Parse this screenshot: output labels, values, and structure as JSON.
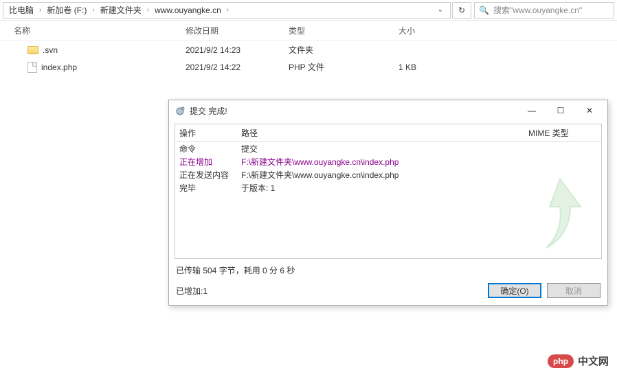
{
  "addressbar": {
    "crumbs": [
      "比电脑",
      "新加卷 (F:)",
      "新建文件夹",
      "www.ouyangke.cn"
    ],
    "search_placeholder": "搜索\"www.ouyangke.cn\""
  },
  "columns": {
    "name": "名称",
    "date": "修改日期",
    "type": "类型",
    "size": "大小"
  },
  "files": [
    {
      "icon": "folder",
      "name": ".svn",
      "date": "2021/9/2 14:23",
      "type": "文件夹",
      "size": ""
    },
    {
      "icon": "file",
      "name": "index.php",
      "date": "2021/9/2 14:22",
      "type": "PHP 文件",
      "size": "1 KB"
    }
  ],
  "dialog": {
    "title": "提交 完成!",
    "log_headers": {
      "op": "操作",
      "path": "路径",
      "mime": "MIME 类型"
    },
    "log_rows": [
      {
        "op": "命令",
        "path": "提交",
        "style": "normal"
      },
      {
        "op": "正在增加",
        "path": "F:\\新建文件夹\\www.ouyangke.cn\\index.php",
        "style": "purple"
      },
      {
        "op": "正在发送内容",
        "path": "F:\\新建文件夹\\www.ouyangke.cn\\index.php",
        "style": "normal"
      },
      {
        "op": "完毕",
        "path": "于版本: 1",
        "style": "normal"
      }
    ],
    "transfer": "已传输 504 字节，耗用 0 分 6 秒",
    "added": "已增加:1",
    "ok": "确定(O)",
    "cancel": "取消"
  },
  "logo": {
    "badge": "php",
    "text": "中文网"
  }
}
